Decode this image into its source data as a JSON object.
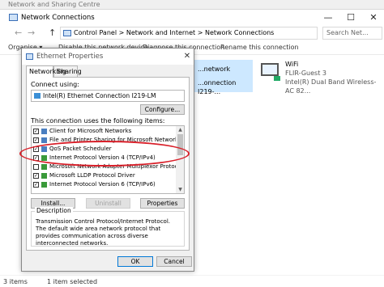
{
  "bg_window": {
    "title": "Network and Sharing Centre"
  },
  "nc_window": {
    "title": "Network Connections",
    "controls": {
      "min": "—",
      "max": "☐",
      "close": "✕"
    },
    "nav": {
      "back": "←",
      "forward": "→",
      "up": "↑"
    },
    "breadcrumb": {
      "part1": "Control Panel",
      "sep": ">",
      "part2": "Network and Internet",
      "part3": "Network Connections"
    },
    "search_placeholder": "Search Net...",
    "commands": [
      "Organise ▾",
      "Disable this network device",
      "Diagnose this connection",
      "Rename this connection"
    ],
    "connections": {
      "ethernet": {
        "line1": "...network",
        "line2": "...onnection I219-..."
      },
      "wifi": {
        "name": "WiFi",
        "ssid": "FLIR-Guest  3",
        "adapter": "Intel(R) Dual Band Wireless-AC 82..."
      }
    },
    "status": {
      "count": "3 items",
      "selected": "1 item selected"
    }
  },
  "dialog": {
    "title": "Ethernet Properties",
    "close": "✕",
    "tabs": [
      "Networking",
      "Sharing"
    ],
    "connect_using_label": "Connect using:",
    "adapter": "Intel(R) Ethernet Connection I219-LM",
    "configure_btn": "Configure...",
    "items_label": "This connection uses the following items:",
    "items": [
      {
        "label": "Client for Microsoft Networks",
        "checked": "✓"
      },
      {
        "label": "File and Printer Sharing for Microsoft Networks",
        "checked": "✓"
      },
      {
        "label": "QoS Packet Scheduler",
        "checked": "✓"
      },
      {
        "label": "Internet Protocol Version 4 (TCP/IPv4)",
        "checked": "✓"
      },
      {
        "label": "Microsoft Network Adapter Multiplexor Protocol",
        "checked": ""
      },
      {
        "label": "Microsoft LLDP Protocol Driver",
        "checked": "✓"
      },
      {
        "label": "Internet Protocol Version 6 (TCP/IPv6)",
        "checked": "✓"
      }
    ],
    "install_btn": "Install...",
    "uninstall_btn": "Uninstall",
    "properties_btn": "Properties",
    "description_label": "Description",
    "description": "Transmission Control Protocol/Internet Protocol. The default wide area network protocol that provides communication across diverse interconnected networks.",
    "ok_btn": "OK",
    "cancel_btn": "Cancel"
  },
  "colors": {
    "highlight_ring": "#d9202a",
    "selection": "#cde8ff",
    "accent": "#0078d7"
  }
}
